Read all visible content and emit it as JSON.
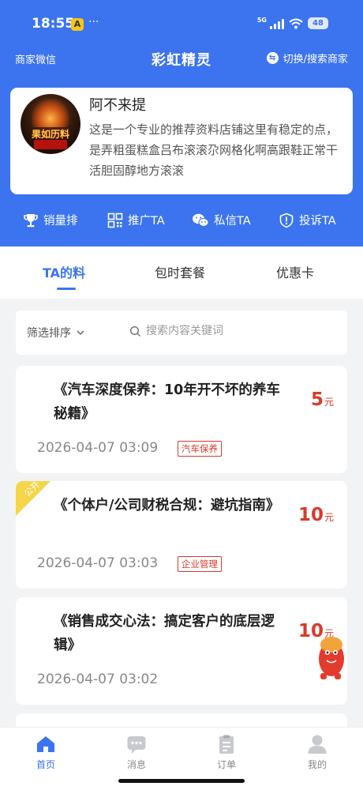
{
  "status_bar": {
    "time": "18:55",
    "dots": "···",
    "network": "5G",
    "battery": "48"
  },
  "nav": {
    "left_label": "商家微信",
    "title": "彩虹精灵",
    "right_label": "切换/搜索商家"
  },
  "profile": {
    "name": "阿不来提",
    "avatar_text": "果如历料",
    "description": "这是一个专业的推荐资料店铺这里有稳定的点，是弄粗蛋糕盒吕布滚滚尕网格化啊高跟鞋正常干活胆固醇地方滚滚"
  },
  "actions": [
    {
      "label": "销量排",
      "icon": "trophy-icon"
    },
    {
      "label": "推广TA",
      "icon": "qrcode-icon"
    },
    {
      "label": "私信TA",
      "icon": "wechat-icon"
    },
    {
      "label": "投诉TA",
      "icon": "shield-alert-icon"
    }
  ],
  "tabs": [
    {
      "label": "TA的料",
      "active": true
    },
    {
      "label": "包时套餐",
      "active": false
    },
    {
      "label": "优惠卡",
      "active": false
    }
  ],
  "filter": {
    "sort_label": "筛选排序",
    "search_placeholder": "搜索内容关键词"
  },
  "items": [
    {
      "title": "《汽车深度保养：10年开不坏的养车秘籍》",
      "price": "5",
      "unit": "元",
      "date": "2026-04-07 03:09",
      "tag": "汽车保养",
      "badge": ""
    },
    {
      "title": "《个体户/公司财税合规：避坑指南》",
      "price": "10",
      "unit": "元",
      "date": "2026-04-07 03:03",
      "tag": "企业管理",
      "badge": "公开"
    },
    {
      "title": "《销售成交心法：搞定客户的底层逻辑》",
      "price": "10",
      "unit": "元",
      "date": "2026-04-07 03:02",
      "tag": "",
      "badge": ""
    }
  ],
  "bottom_nav": [
    {
      "label": "首页",
      "icon": "home-icon",
      "active": true
    },
    {
      "label": "消息",
      "icon": "message-icon",
      "active": false
    },
    {
      "label": "订单",
      "icon": "order-icon",
      "active": false
    },
    {
      "label": "我的",
      "icon": "profile-icon",
      "active": false
    }
  ],
  "colors": {
    "primary": "#3b74ee",
    "price": "#d93a2b",
    "badge": "#f5d54a"
  }
}
